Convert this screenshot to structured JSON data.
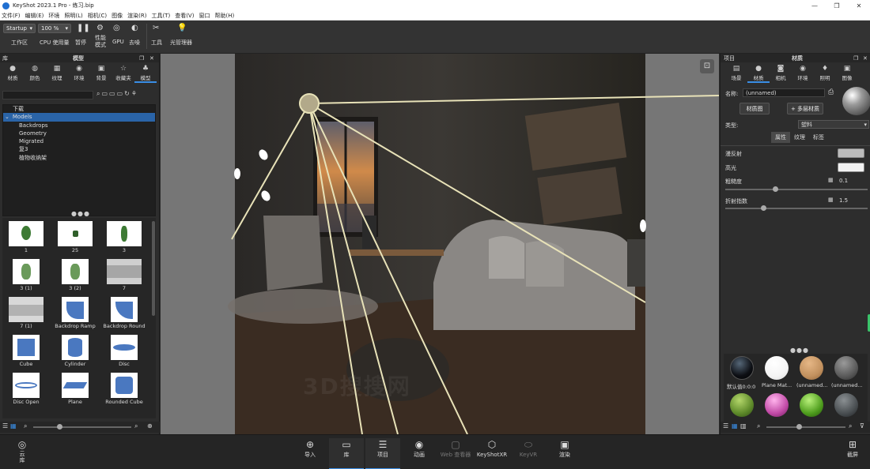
{
  "window": {
    "title": "KeyShot 2023.1 Pro - 练习.bip",
    "controls": [
      "—",
      "❐",
      "✕"
    ]
  },
  "menu": [
    "文件(F)",
    "编辑(E)",
    "环境",
    "照明(L)",
    "相机(C)",
    "图像",
    "渲染(R)",
    "工具(T)",
    "查看(V)",
    "窗口",
    "帮助(H)"
  ],
  "toolbar": {
    "workspace_value": "Startup",
    "workspace_label": "工作区",
    "zoom_value": "100 %",
    "cpu_label": "CPU 使用量",
    "pause_label": "暂停",
    "perf_label_1": "性能",
    "perf_label_2": "模式",
    "gpu_label": "GPU",
    "denoise_label": "去噪",
    "tools_label": "工具",
    "lightmgr_label": "光管理器"
  },
  "library": {
    "panel_title": "库",
    "header_title": "模型",
    "tabs": [
      {
        "label": "材质",
        "icon": "material-ball-icon"
      },
      {
        "label": "颜色",
        "icon": "palette-icon"
      },
      {
        "label": "纹理",
        "icon": "texture-icon"
      },
      {
        "label": "环境",
        "icon": "globe-icon"
      },
      {
        "label": "背景",
        "icon": "image-icon"
      },
      {
        "label": "收藏夹",
        "icon": "star-icon"
      },
      {
        "label": "模型",
        "icon": "models-icon"
      }
    ],
    "tree": [
      "下载",
      "Models",
      "Backdrops",
      "Geometry",
      "Migrated",
      "复3",
      "植物收纳架"
    ],
    "items": [
      {
        "label": "1"
      },
      {
        "label": "25"
      },
      {
        "label": "3"
      },
      {
        "label": "3 (1)"
      },
      {
        "label": "3 (2)"
      },
      {
        "label": "7"
      },
      {
        "label": "7 (1)"
      },
      {
        "label": "Backdrop Ramp"
      },
      {
        "label": "Backdrop Round"
      },
      {
        "label": "Cube"
      },
      {
        "label": "Cylinder"
      },
      {
        "label": "Disc"
      },
      {
        "label": "Disc Open"
      },
      {
        "label": "Plane"
      },
      {
        "label": "Rounded Cube"
      }
    ]
  },
  "project": {
    "panel_title": "项目",
    "header_title": "材质",
    "tabs": [
      {
        "label": "场景",
        "icon": "scene-icon"
      },
      {
        "label": "材质",
        "icon": "material-icon"
      },
      {
        "label": "相机",
        "icon": "camera-icon"
      },
      {
        "label": "环境",
        "icon": "environment-icon"
      },
      {
        "label": "照明",
        "icon": "lightbulb-icon"
      },
      {
        "label": "图像",
        "icon": "image-icon"
      }
    ],
    "name_label": "名称:",
    "name_value": "(unnamed)",
    "material_graph_btn": "材质图",
    "multi_material_btn": "+ 多层材质",
    "type_label": "类型:",
    "type_value": "塑料",
    "subtabs": [
      "属性",
      "纹理",
      "标签"
    ],
    "props": [
      {
        "label": "漫反射",
        "value": ""
      },
      {
        "label": "高光",
        "value": ""
      },
      {
        "label": "粗糙度",
        "value": "0.1"
      },
      {
        "label": "折射指数",
        "value": "1.5"
      }
    ],
    "materials": [
      {
        "label": "默认值0:0:0"
      },
      {
        "label": "Plane Mat..."
      },
      {
        "label": "(unnamed..."
      },
      {
        "label": "(unnamed..."
      }
    ]
  },
  "bottombar": [
    {
      "label": "导入",
      "icon": "import-icon"
    },
    {
      "label": "库",
      "icon": "library-book-icon"
    },
    {
      "label": "项目",
      "icon": "project-list-icon"
    },
    {
      "label": "动画",
      "icon": "animation-icon"
    },
    {
      "label": "Web 查看器",
      "icon": "web-viewer-icon"
    },
    {
      "label": "KeyShotXR",
      "icon": "keyshotxr-icon"
    },
    {
      "label": "KeyVR",
      "icon": "keyvr-icon"
    },
    {
      "label": "渲染",
      "icon": "render-icon"
    }
  ],
  "cloud_label_1": "云",
  "cloud_label_2": "库",
  "screenshot_label": "截屏",
  "watermark": "3D搜搜网",
  "colors": {
    "accent": "#3a8ee6",
    "panel": "#2d2d2d",
    "viewport_gray": "#767676",
    "light_beam": "#e8e2b8"
  }
}
